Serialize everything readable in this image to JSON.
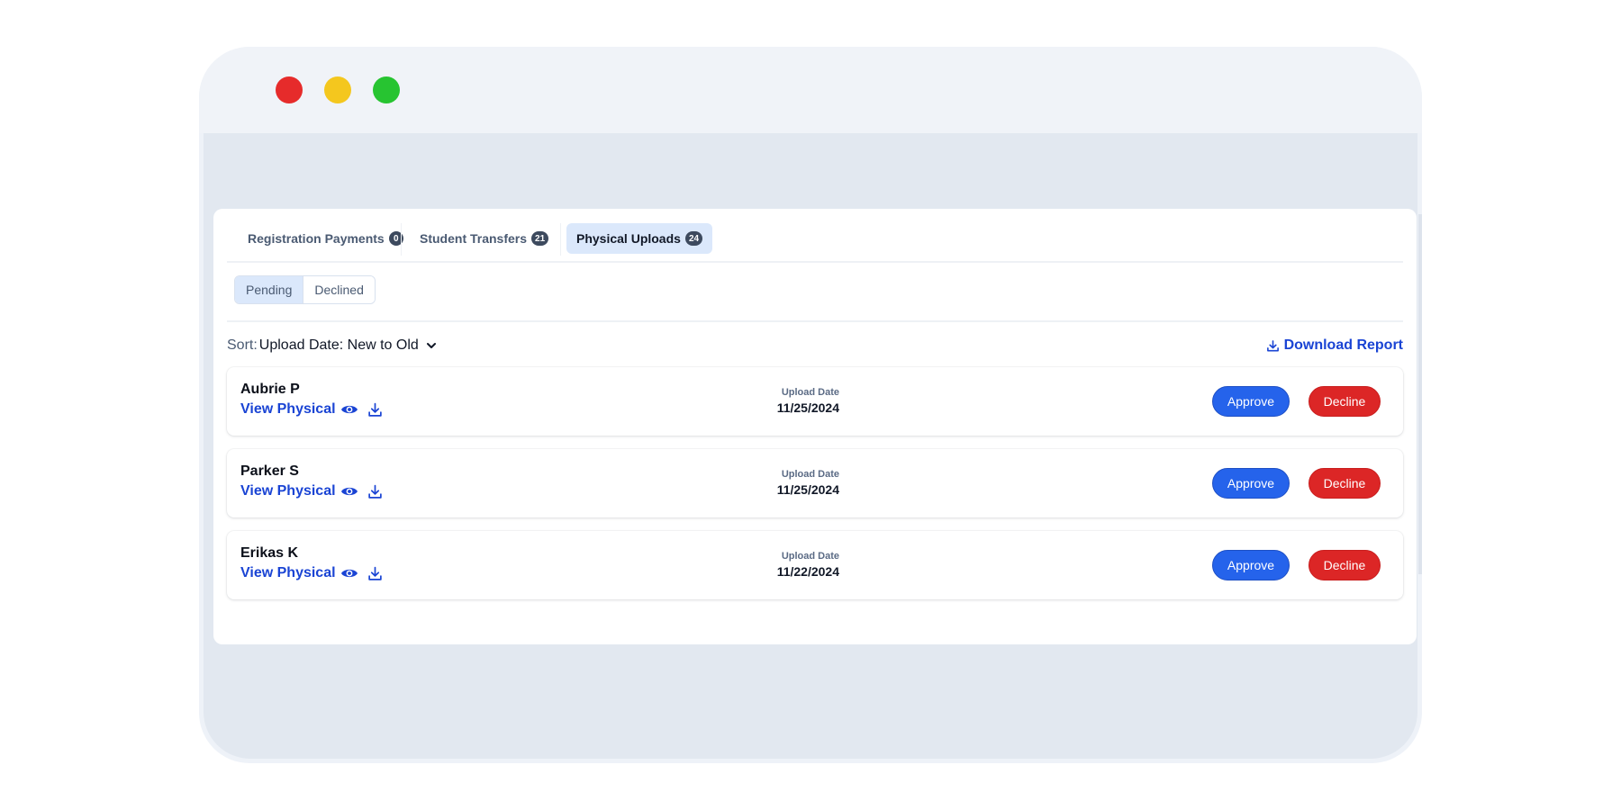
{
  "window": {
    "controls": [
      "close",
      "minimize",
      "maximize"
    ]
  },
  "tabs": [
    {
      "label": "Registration Payments",
      "count": "0",
      "active": false
    },
    {
      "label": "Student Transfers",
      "count": "21",
      "active": false
    },
    {
      "label": "Physical Uploads",
      "count": "24",
      "active": true
    }
  ],
  "filters": [
    {
      "label": "Pending",
      "active": true
    },
    {
      "label": "Declined",
      "active": false
    }
  ],
  "sort": {
    "label": "Sort:",
    "value": "Upload Date: New to Old",
    "icon": "chevron-down-icon"
  },
  "download_report": {
    "label": "Download Report",
    "icon": "download-icon"
  },
  "rows": [
    {
      "name": "Aubrie P",
      "view_label": "View Physical",
      "date_label": "Upload Date",
      "date": "11/25/2024",
      "approve_label": "Approve",
      "decline_label": "Decline"
    },
    {
      "name": "Parker S",
      "view_label": "View Physical",
      "date_label": "Upload Date",
      "date": "11/25/2024",
      "approve_label": "Approve",
      "decline_label": "Decline"
    },
    {
      "name": "Erikas K",
      "view_label": "View Physical",
      "date_label": "Upload Date",
      "date": "11/22/2024",
      "approve_label": "Approve",
      "decline_label": "Decline"
    }
  ],
  "colors": {
    "primary": "#1a44d4",
    "approve": "#2563eb",
    "decline": "#dc2626",
    "active_tab_bg": "#dbe8fb"
  }
}
